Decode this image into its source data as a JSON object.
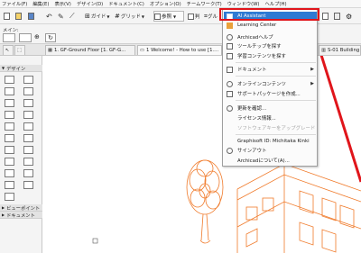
{
  "menubar": {
    "items": [
      "ファイル(F)",
      "編集(E)",
      "表示(V)",
      "デザイン(D)",
      "ドキュメント(C)",
      "オプション(O)",
      "チームワーク(T)",
      "ウィンドウ(W)",
      "ヘルプ(H)"
    ]
  },
  "toolbar": {
    "guide_label": "ガイド",
    "grid_label": "グリッド",
    "ref_label": "参照",
    "num_label": "判",
    "gr_label": "グル"
  },
  "info_label": "メイン:",
  "tabs": [
    "1. GF-Ground Floor [1. GF-G...",
    "1 Welcome! - How to use [1....",
    "S-01 Building"
  ],
  "palette": {
    "section_design": "デザイン",
    "section_viewpoint": "ビューポイント",
    "section_document": "ドキュメント"
  },
  "dropdown": {
    "items": [
      {
        "label": "AI Assistant",
        "icon": "ai-icon",
        "highlighted": true
      },
      {
        "label": "Learning Center",
        "icon": "learning-icon"
      },
      {
        "label": "Archicadヘルプ",
        "icon": "help-icon"
      },
      {
        "label": "ツールチップを探す",
        "icon": "tooltip-icon"
      },
      {
        "label": "学習コンテンツを探す",
        "icon": "content-icon"
      },
      {
        "label": "ドキュメント",
        "icon": "document-icon",
        "submenu": true
      },
      {
        "label": "オンラインコンテンツ",
        "icon": "online-icon",
        "submenu": true
      },
      {
        "label": "サポートパッケージを作成...",
        "icon": "support-icon"
      },
      {
        "label": "更新を確認...",
        "icon": "update-icon"
      },
      {
        "label": "ライセンス情報...",
        "icon": "license-icon"
      },
      {
        "label": "ソフトウェアキーをアップグレード",
        "icon": "",
        "disabled": true
      },
      {
        "label": "Graphisoft ID: Michitaka Kinki",
        "icon": ""
      },
      {
        "label": "サインアウト",
        "icon": "signout-icon"
      },
      {
        "label": "Archicadについて(A)...",
        "icon": ""
      }
    ]
  },
  "colors": {
    "highlight": "#2f7ad3",
    "callout": "#e0151b",
    "model_lines": "#f07a2a"
  }
}
